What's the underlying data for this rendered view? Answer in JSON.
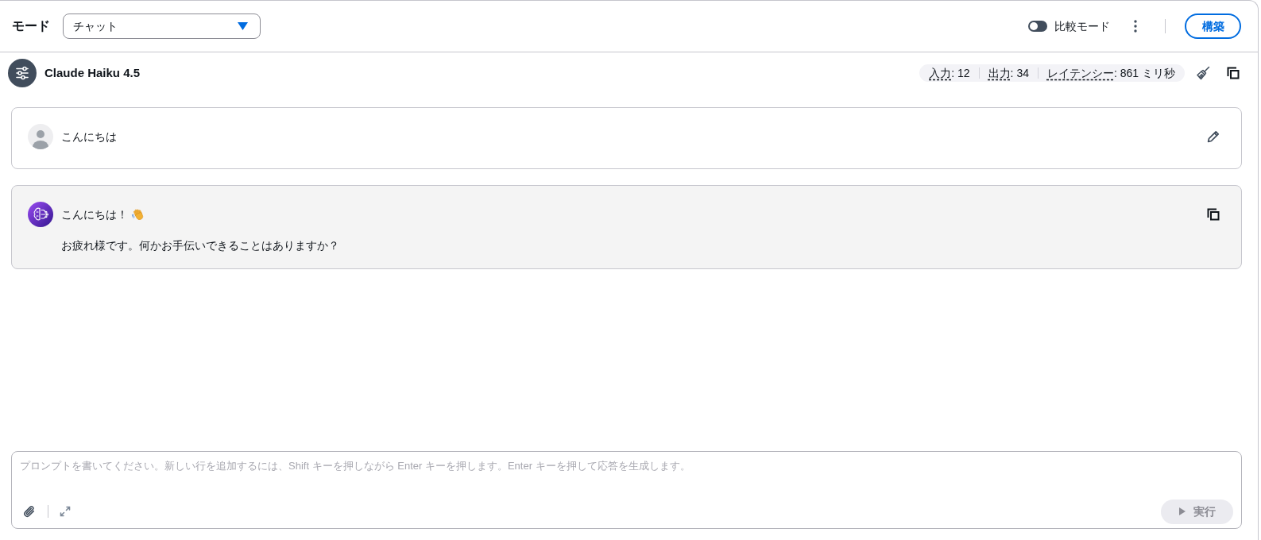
{
  "header": {
    "mode_label": "モード",
    "mode_select": {
      "value": "チャット"
    },
    "compare_toggle": {
      "label": "比較モード",
      "on": false
    },
    "build_button": "構築"
  },
  "model_bar": {
    "model_name": "Claude Haiku 4.5",
    "stats": [
      {
        "label": "入力",
        "value": ": 12"
      },
      {
        "label": "出力",
        "value": ": 34"
      },
      {
        "label": "レイテンシー",
        "value": ": 861 ミリ秒"
      }
    ]
  },
  "messages": [
    {
      "kind": "user",
      "lines": [
        {
          "text": "こんにちは",
          "trailing_icon": false
        }
      ]
    },
    {
      "kind": "assistant",
      "lines": [
        {
          "text": "こんにちは！",
          "trailing_icon": true
        },
        {
          "text": "お疲れ様です。何かお手伝いできることはありますか？",
          "trailing_icon": false
        }
      ]
    }
  ],
  "prompt": {
    "placeholder": "プロンプトを書いてください。新しい行を追加するには、Shift キーを押しながら Enter キーを押します。Enter キーを押して応答を生成します。",
    "run_button": {
      "label": "実行",
      "disabled": true
    }
  }
}
